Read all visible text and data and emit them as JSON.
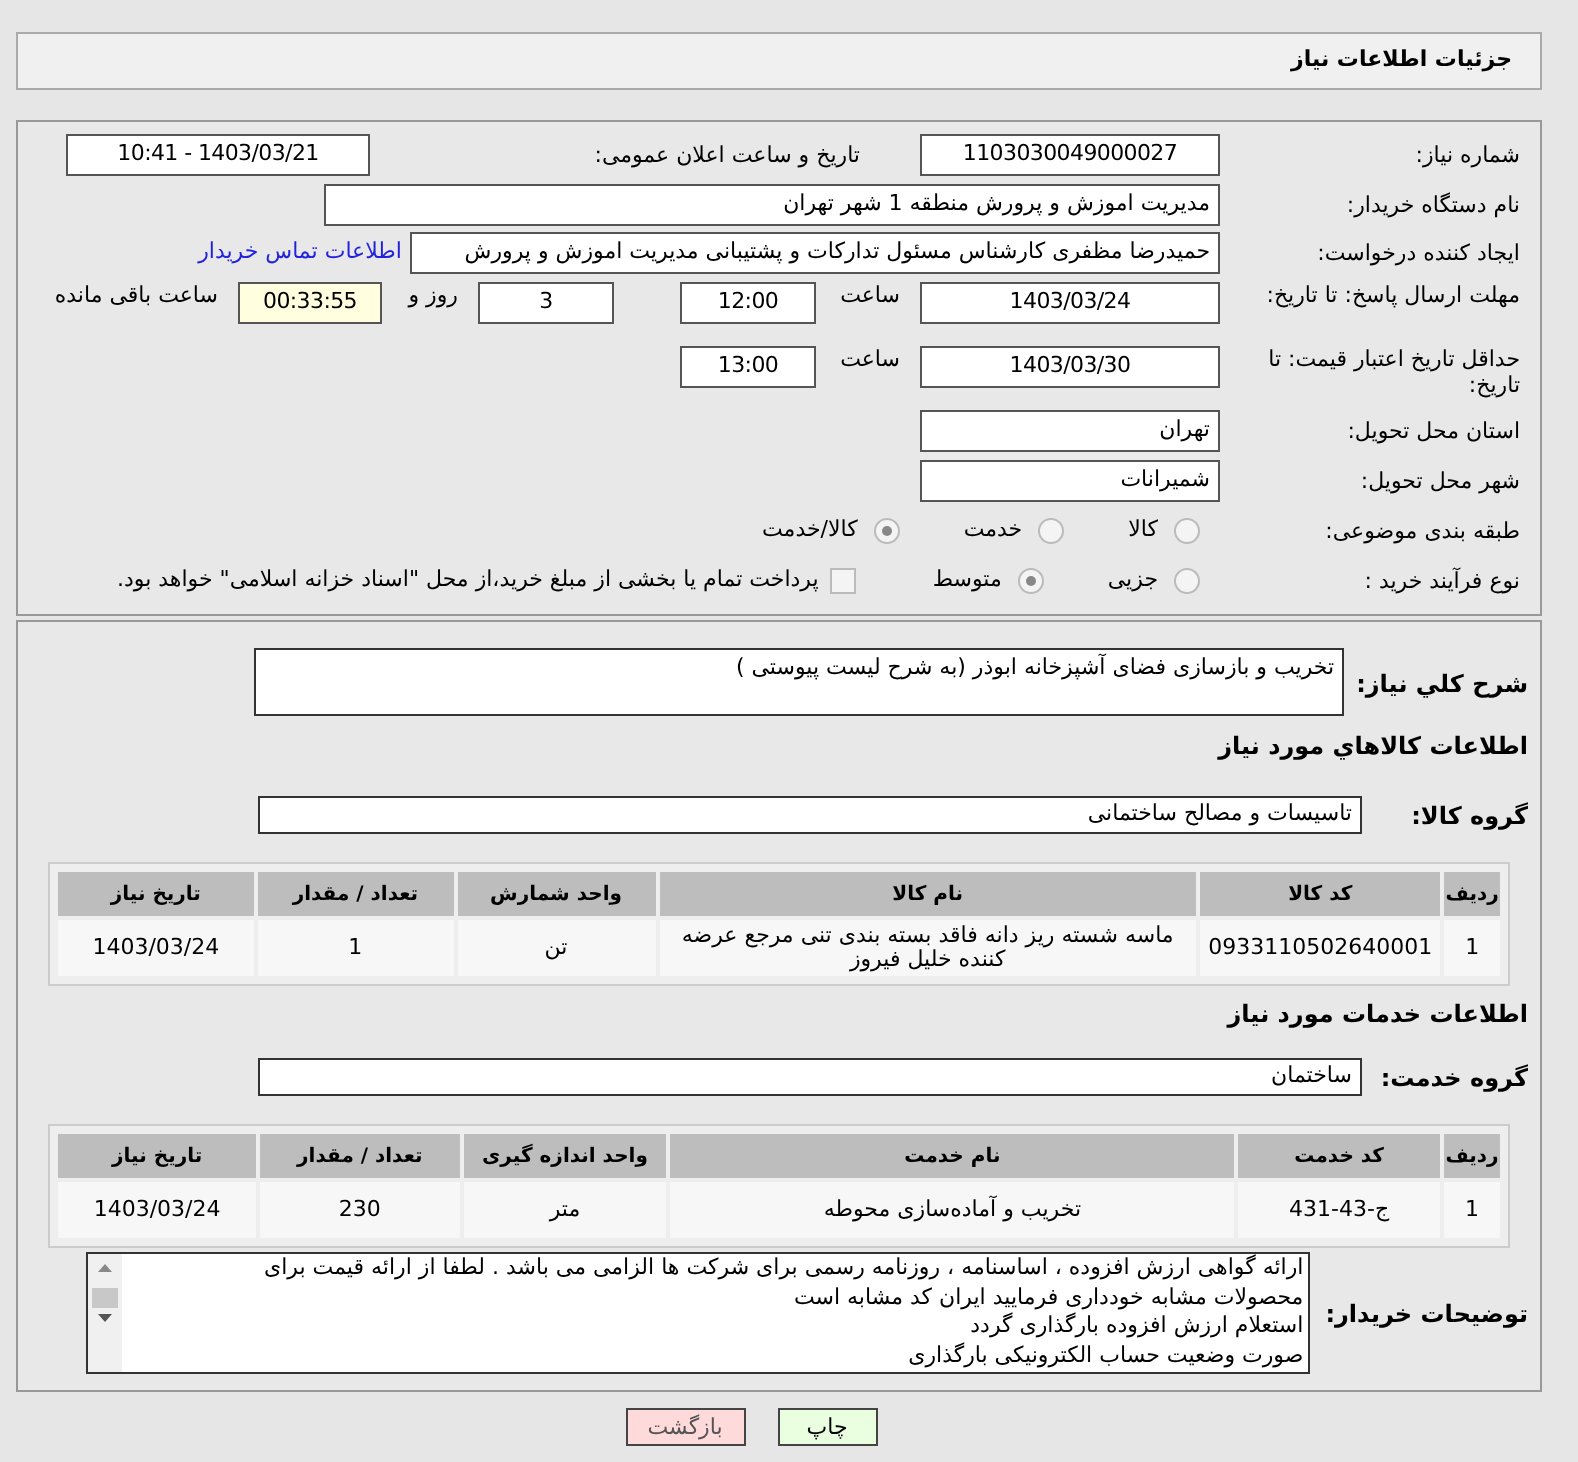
{
  "page_title": "جزئیات اطلاعات نیاز",
  "need_number": {
    "label": "شماره نیاز:",
    "value": "1103030049000027"
  },
  "announce": {
    "label": "تاریخ و ساعت اعلان عمومی:",
    "value": "1403/03/21 - 10:41"
  },
  "buyer": {
    "label": "نام دستگاه خریدار:",
    "value": "مدیریت اموزش و پرورش منطقه 1 شهر تهران"
  },
  "requester": {
    "label": "ایجاد کننده درخواست:",
    "value": "حمیدرضا مظفری کارشناس مسئول تدارکات و پشتیبانی مدیریت اموزش و پرورش",
    "link": "اطلاعات تماس خریدار"
  },
  "reply_deadline": {
    "label": "مهلت ارسال پاسخ: تا تاریخ:",
    "date": "1403/03/24",
    "time_label": "ساعت",
    "time": "12:00",
    "days": "3",
    "days_label": "روز و",
    "remaining": "00:33:55",
    "remaining_label": "ساعت باقی مانده"
  },
  "price_validity": {
    "label": "حداقل تاریخ اعتبار قیمت: تا تاریخ:",
    "date": "1403/03/30",
    "time_label": "ساعت",
    "time": "13:00"
  },
  "province": {
    "label": "استان محل تحویل:",
    "value": "تهران"
  },
  "city": {
    "label": "شهر محل تحویل:",
    "value": "شمیرانات"
  },
  "category": {
    "label": "طبقه بندی موضوعی:",
    "options": [
      {
        "label": "کالا",
        "selected": false
      },
      {
        "label": "خدمت",
        "selected": false
      },
      {
        "label": "کالا/خدمت",
        "selected": true
      }
    ]
  },
  "process": {
    "label": "نوع فرآیند خرید :",
    "options": [
      {
        "label": "جزیی",
        "selected": false
      },
      {
        "label": "متوسط",
        "selected": true
      }
    ],
    "payment": {
      "checked": false,
      "label": "پرداخت تمام یا بخشی از مبلغ خرید،از محل \"اسناد خزانه اسلامی\" خواهد بود."
    }
  },
  "description": {
    "label": "شرح کلي نياز:",
    "value": "تخریب و بازسازی فضای آشپزخانه ابوذر (به شرح لیست پیوستی )"
  },
  "goods": {
    "heading": "اطلاعات کالاهاي مورد نياز",
    "group_label": "گروه کالا:",
    "group": "تاسیسات و مصالح ساختمانی",
    "columns": [
      "ردیف",
      "کد کالا",
      "نام کالا",
      "واحد شمارش",
      "تعداد / مقدار",
      "تاریخ نیاز"
    ],
    "rows": [
      [
        "1",
        "0933110502640001",
        "ماسه شسته ریز دانه فاقد بسته بندی تنی مرجع عرضه کننده خلیل فیروز",
        "تن",
        "1",
        "1403/03/24"
      ]
    ]
  },
  "services": {
    "heading": "اطلاعات خدمات مورد نياز",
    "group_label": "گروه خدمت:",
    "group": "ساختمان",
    "columns": [
      "ردیف",
      "کد خدمت",
      "نام خدمت",
      "واحد اندازه گیری",
      "تعداد / مقدار",
      "تاریخ نیاز"
    ],
    "rows": [
      [
        "1",
        "ج-43-431",
        "تخریب و آماده‌سازی محوطه",
        "متر",
        "230",
        "1403/03/24"
      ]
    ]
  },
  "notes": {
    "label": "توضیحات خریدار:",
    "lines": [
      "ارائه گواهی ارزش افزوده ، اساسنامه  ، روزنامه رسمی برای شرکت ها الزامی می باشد . لطفا از ارائه قیمت برای",
      "محصولات مشابه خودداری فرمایید ایران کد مشابه است",
      "استعلام ارزش افزوده بارگذاری گردد",
      "صورت وضعیت حساب الکترونیکی بارگذاری"
    ]
  },
  "buttons": [
    {
      "label": "چاپ",
      "kind": "print"
    },
    {
      "label": "بازگشت",
      "kind": "back"
    }
  ]
}
